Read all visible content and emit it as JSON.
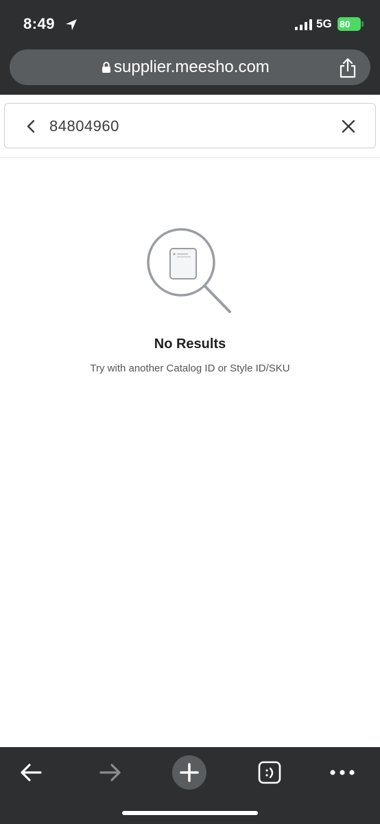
{
  "status_bar": {
    "time": "8:49",
    "network": "5G",
    "battery": "80"
  },
  "browser": {
    "url": "supplier.meesho.com"
  },
  "search": {
    "value": "84804960"
  },
  "empty_state": {
    "title": "No Results",
    "subtitle": "Try with another Catalog ID or Style ID/SKU"
  },
  "colors": {
    "chrome_bg": "#2d2f30",
    "url_bar_bg": "#5a5d5f",
    "battery_green": "#4cd964",
    "illustration_gray": "#9a9da1"
  },
  "icons": {
    "location": "location-arrow-icon",
    "signal": "signal-bars-icon",
    "lock": "lock-icon",
    "share": "share-icon",
    "back": "chevron-left-icon",
    "clear": "close-icon",
    "empty": "magnifier-document-icon",
    "nav_back": "arrow-left-icon",
    "nav_forward": "arrow-right-icon",
    "new_tab": "plus-icon",
    "tabs": "tabs-icon",
    "more": "more-dots-icon"
  }
}
